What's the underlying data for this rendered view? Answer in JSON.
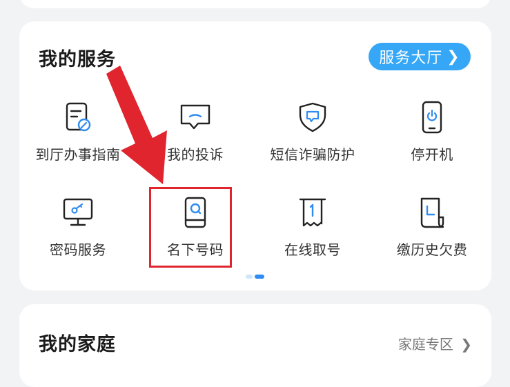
{
  "services": {
    "title": "我的服务",
    "hall_button": {
      "label": "服务大厅",
      "chevron": "❯"
    },
    "items": [
      {
        "label": "到厅办事指南",
        "icon": "document-guide-icon"
      },
      {
        "label": "我的投诉",
        "icon": "chat-bubble-icon"
      },
      {
        "label": "短信诈骗防护",
        "icon": "shield-message-icon"
      },
      {
        "label": "停开机",
        "icon": "phone-power-icon"
      },
      {
        "label": "密码服务",
        "icon": "monitor-key-icon"
      },
      {
        "label": "名下号码",
        "icon": "book-search-icon"
      },
      {
        "label": "在线取号",
        "icon": "ticket-number-icon"
      },
      {
        "label": "缴历史欠费",
        "icon": "bill-icon"
      }
    ],
    "pager": {
      "pages": 2,
      "active_page": 2
    }
  },
  "family": {
    "title": "我的家庭",
    "link": {
      "label": "家庭专区",
      "chevron": "❯"
    }
  },
  "colors": {
    "accent": "#35a7f6",
    "icon_blue": "#2f8cf0",
    "annotation_red": "#e0252e"
  }
}
